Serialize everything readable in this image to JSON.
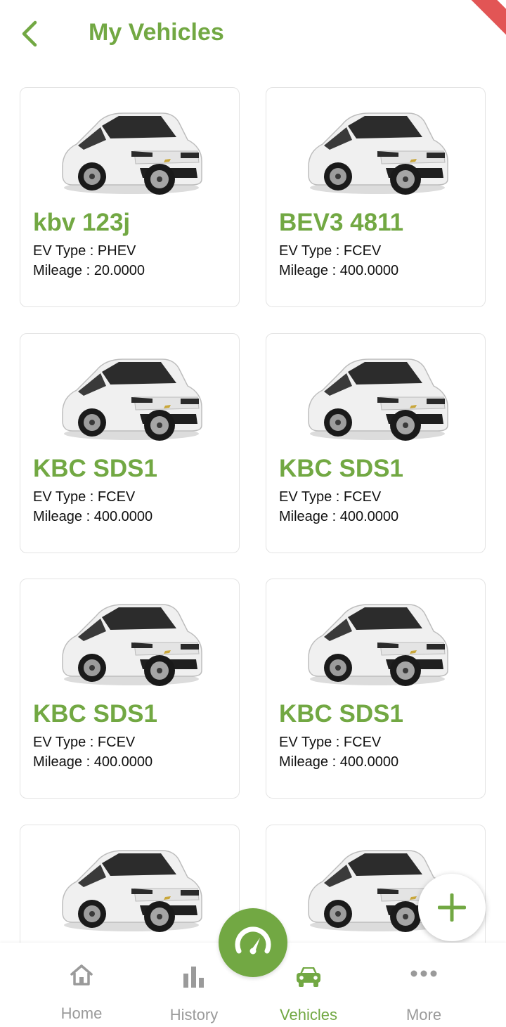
{
  "header": {
    "title": "My Vehicles"
  },
  "vehicles": [
    {
      "plate": "kbv 123j",
      "ev_type_line": "EV Type : PHEV",
      "mileage_line": "Mileage : 20.0000"
    },
    {
      "plate": "BEV3 4811",
      "ev_type_line": "EV Type : FCEV",
      "mileage_line": "Mileage : 400.0000"
    },
    {
      "plate": "KBC SDS1",
      "ev_type_line": "EV Type : FCEV",
      "mileage_line": "Mileage : 400.0000"
    },
    {
      "plate": "KBC SDS1",
      "ev_type_line": "EV Type : FCEV",
      "mileage_line": "Mileage : 400.0000"
    },
    {
      "plate": "KBC SDS1",
      "ev_type_line": "EV Type : FCEV",
      "mileage_line": "Mileage : 400.0000"
    },
    {
      "plate": "KBC SDS1",
      "ev_type_line": "EV Type : FCEV",
      "mileage_line": "Mileage : 400.0000"
    },
    {
      "plate": "",
      "ev_type_line": "",
      "mileage_line": ""
    },
    {
      "plate": "",
      "ev_type_line": "",
      "mileage_line": ""
    }
  ],
  "nav": {
    "items": [
      {
        "label": "Home",
        "icon": "home-icon"
      },
      {
        "label": "History",
        "icon": "bar-chart-icon"
      },
      {
        "label": "Vehicles",
        "icon": "car-icon"
      },
      {
        "label": "More",
        "icon": "more-dots-icon"
      }
    ],
    "active": "Vehicles"
  },
  "colors": {
    "accent": "#72a843",
    "inactive": "#9a9a9a",
    "ribbon": "#e25555"
  },
  "icons": {
    "back": "back-chevron-icon",
    "add": "plus-icon",
    "center": "speedometer-icon"
  }
}
